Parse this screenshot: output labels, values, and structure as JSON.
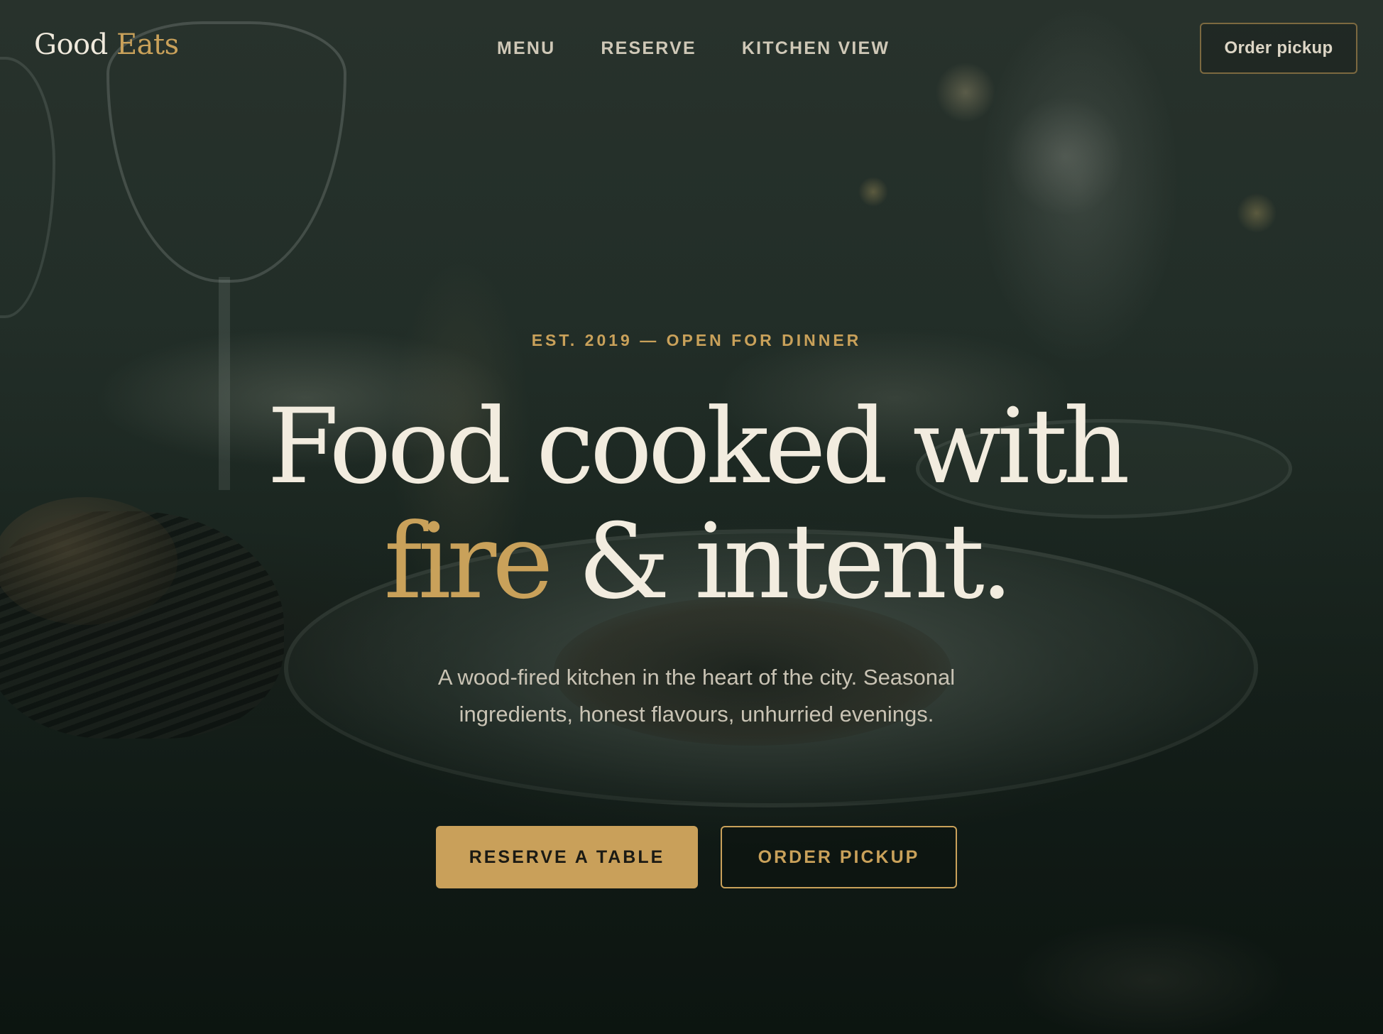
{
  "brand": {
    "name_primary": "Good",
    "name_accent": "Eats"
  },
  "nav": {
    "links": [
      {
        "label": "MENU"
      },
      {
        "label": "RESERVE"
      },
      {
        "label": "KITCHEN VIEW"
      }
    ],
    "cta_label": "Order pickup"
  },
  "hero": {
    "eyebrow": "EST. 2019 — OPEN FOR DINNER",
    "headline_line1": "Food cooked with",
    "headline_gold": "fire",
    "headline_rest": " & intent.",
    "lede": "A wood-fired kitchen in the heart of the city. Seasonal ingredients, honest flavours, unhurried evenings.",
    "primary_button": "RESERVE A TABLE",
    "secondary_button": "ORDER PICKUP"
  },
  "colors": {
    "accent_gold": "#c9a15a",
    "headline_cream": "#f2ecdf",
    "background_dark": "#15201b"
  }
}
